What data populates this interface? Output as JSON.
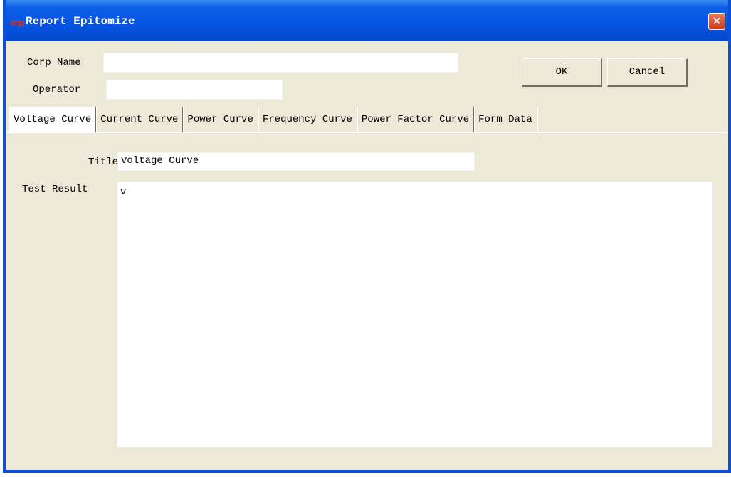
{
  "window": {
    "title": "Report Epitomize",
    "logo_text": "imp",
    "close_symbol": "✕"
  },
  "header": {
    "corp_name_label": "Corp Name",
    "corp_name_value": "",
    "operator_label": "Operator",
    "operator_value": "",
    "ok_label": "OK",
    "cancel_label": "Cancel"
  },
  "tabs": [
    {
      "label": "Voltage Curve",
      "active": true
    },
    {
      "label": "Current Curve"
    },
    {
      "label": "Power Curve"
    },
    {
      "label": "Frequency Curve"
    },
    {
      "label": "Power Factor Curve"
    },
    {
      "label": "Form Data"
    }
  ],
  "form": {
    "title_label": "Title",
    "title_value": "Voltage Curve",
    "test_result_label": "Test Result",
    "test_result_value": "v"
  },
  "colors": {
    "titlebar": "#0554e3",
    "dialog_bg": "#ece9d8",
    "close_button": "#c83b1c"
  }
}
